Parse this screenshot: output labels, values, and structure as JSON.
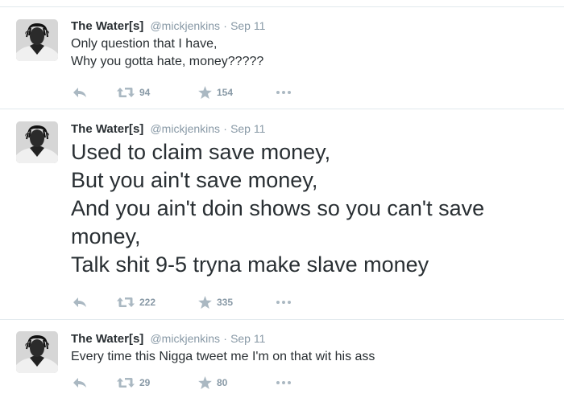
{
  "tweets": [
    {
      "name": "The Water[s]",
      "handle": "@mickjenkins",
      "separator": "·",
      "time": "Sep 11",
      "lines": [
        "Only question that I have,",
        "Why you gotta hate, money?????"
      ],
      "retweets": "94",
      "favorites": "154"
    },
    {
      "name": "The Water[s]",
      "handle": "@mickjenkins",
      "separator": "·",
      "time": "Sep 11",
      "lines": [
        "Used to claim save money,",
        "But you ain't save money,",
        "And you ain't doin shows so you can't save",
        "money,",
        "Talk shit 9-5 tryna make slave money"
      ],
      "retweets": "222",
      "favorites": "335"
    },
    {
      "name": "The Water[s]",
      "handle": "@mickjenkins",
      "separator": "·",
      "time": "Sep 11",
      "lines": [
        "Every time this Nigga tweet me I'm on that wit his ass"
      ],
      "retweets": "29",
      "favorites": "80"
    }
  ],
  "icons": {
    "reply": "reply-icon",
    "retweet": "retweet-icon",
    "favorite": "star-icon",
    "more": "more-dots-icon"
  },
  "colors": {
    "text": "#292f33",
    "meta": "#8899a6",
    "action": "#aab8c2",
    "divider": "#e1e8ed"
  }
}
